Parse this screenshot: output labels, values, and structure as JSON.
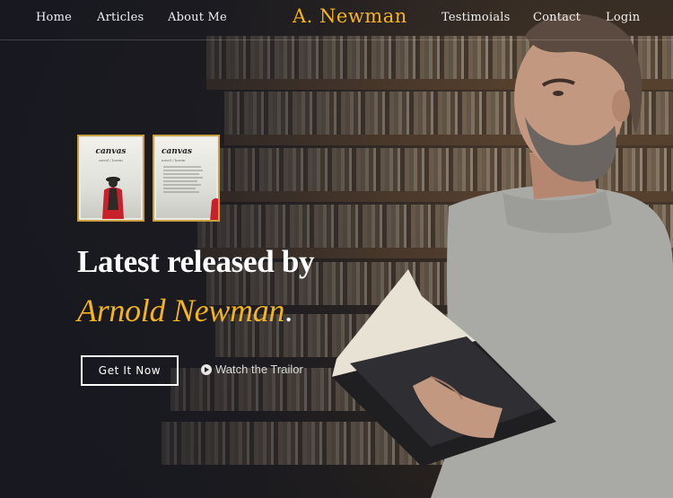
{
  "nav": {
    "left": [
      "Home",
      "Articles",
      "About Me"
    ],
    "brand": "A. Newman",
    "right": [
      "Testimoials",
      "Contact",
      "Login"
    ]
  },
  "books": [
    {
      "title": "canvas",
      "subtitle": "novel / lorem"
    },
    {
      "title": "canvas",
      "subtitle": "novel / lorem"
    }
  ],
  "hero": {
    "headline": "Latest released by",
    "author": "Arnold Newman",
    "author_suffix": "."
  },
  "actions": {
    "primary_label": "Get It Now",
    "secondary_label": "Watch the Trailor",
    "play_icon": "play-circle-icon"
  },
  "colors": {
    "accent": "#f5b41b",
    "background": "#1b1c22",
    "text": "#ffffff"
  }
}
